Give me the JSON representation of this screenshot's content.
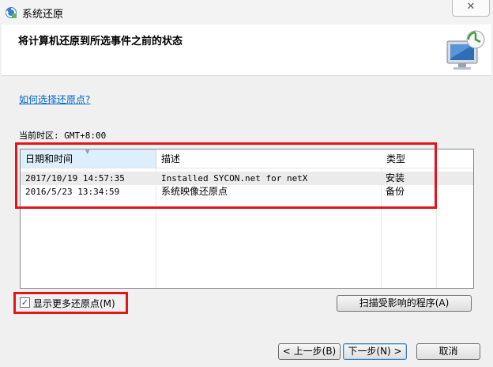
{
  "window": {
    "title": "系统还原",
    "close_glyph": "✕"
  },
  "header": {
    "title": "将计算机还原到所选事件之前的状态"
  },
  "help_link": "如何选择还原点?",
  "timezone": "当前时区: GMT+8:00",
  "table": {
    "columns": [
      "日期和时间",
      "描述",
      "类型"
    ],
    "rows": [
      {
        "datetime": "2017/10/19 14:57:35",
        "description": "Installed SYCON.net for netX",
        "type": "安装",
        "selected": true
      },
      {
        "datetime": "2016/5/23 13:34:59",
        "description": "系统映像还原点",
        "type": "备份",
        "selected": false
      }
    ]
  },
  "show_more": {
    "label": "显示更多还原点(M)",
    "checked": true,
    "check_glyph": "✓"
  },
  "buttons": {
    "scan": "扫描受影响的程序(A)",
    "back": "< 上一步(B)",
    "next": "下一步(N) >",
    "cancel": "取消"
  },
  "colors": {
    "highlight": "#e0161b",
    "link": "#0066cc",
    "sorted_header": "#dceffb"
  }
}
